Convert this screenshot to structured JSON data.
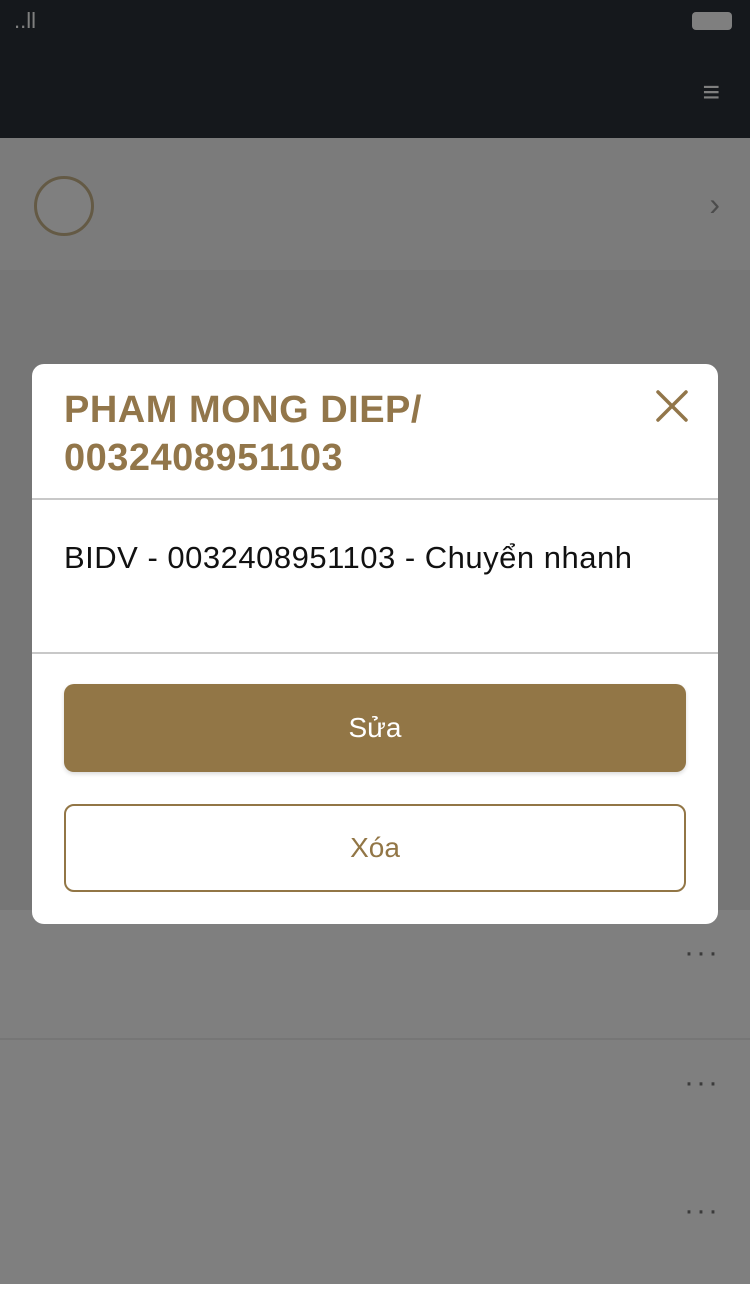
{
  "status_bar": {
    "signal": "..ll",
    "time": "",
    "battery": ""
  },
  "header": {
    "title": "",
    "menu": "≡"
  },
  "new_beneficiary": {
    "label": "",
    "chevron": "›"
  },
  "list": {
    "title": "",
    "items": [
      {
        "name": "",
        "detail": ""
      },
      {
        "name": "",
        "detail": ""
      },
      {
        "name": "",
        "detail": ""
      }
    ]
  },
  "dialog": {
    "title_line1": "PHAM MONG DIEP/",
    "title_line2": "0032408951103",
    "description": "BIDV - 0032408951103 - Chuyển nhanh",
    "edit_label": "Sửa",
    "delete_label": "Xóa",
    "accent": "#927646"
  }
}
